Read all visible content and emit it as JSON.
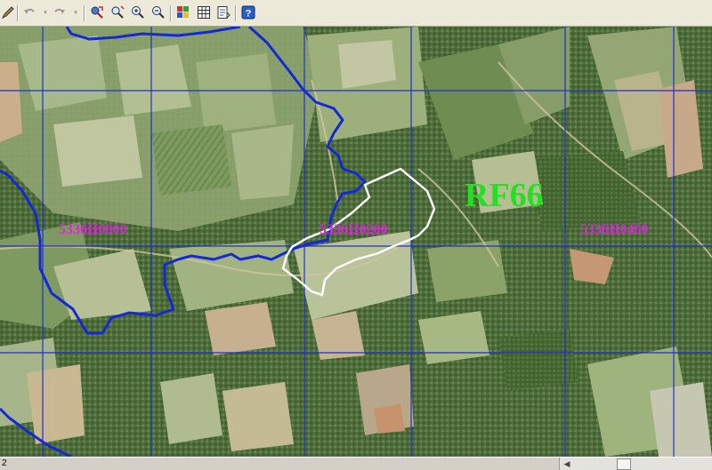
{
  "toolbar": {
    "buttons": [
      {
        "name": "edit-tool-button",
        "icon": "pencil-icon"
      },
      {
        "name": "undo-button",
        "icon": "undo-icon"
      },
      {
        "name": "redo-button",
        "icon": "redo-icon"
      },
      {
        "name": "pan-button",
        "icon": "pan-icon"
      },
      {
        "name": "zoom-extent-button",
        "icon": "zoom-extent-icon"
      },
      {
        "name": "zoom-in-button",
        "icon": "zoom-in-icon"
      },
      {
        "name": "zoom-out-button",
        "icon": "zoom-out-icon"
      },
      {
        "name": "layers-button",
        "icon": "layers-icon"
      },
      {
        "name": "table-button",
        "icon": "table-icon"
      },
      {
        "name": "report-button",
        "icon": "report-icon"
      },
      {
        "name": "help-button",
        "icon": "help-icon"
      }
    ]
  },
  "map": {
    "feature_label": "RF66",
    "tile_labels": [
      "5336II0000",
      "5336II0200",
      "5336II0400"
    ],
    "colors": {
      "grid": "#1f2fd0",
      "boundary": "#1428d8",
      "parcel": "#ffffff",
      "tile_label": "#e020e0",
      "feature_label": "#22e022"
    }
  },
  "statusbar": {
    "text": "2"
  }
}
